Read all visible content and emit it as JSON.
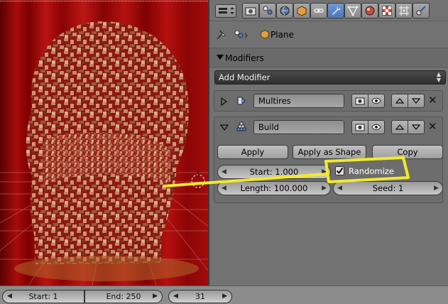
{
  "viewport": {
    "label": "3D viewport with partially built head mesh"
  },
  "properties": {
    "context_tabs": [
      "render",
      "scene",
      "world",
      "object",
      "constraints",
      "modifiers",
      "data",
      "material",
      "texture",
      "particles",
      "physics"
    ],
    "active_tab": "modifiers",
    "path": {
      "object_name": "Plane"
    },
    "section_title": "Modifiers",
    "add_modifier_label": "Add Modifier",
    "modifiers": [
      {
        "name": "Multires",
        "expanded": false
      },
      {
        "name": "Build",
        "expanded": true,
        "apply_label": "Apply",
        "apply_shape_label": "Apply as Shape",
        "copy_label": "Copy",
        "start_label": "Start: 1.000",
        "length_label": "Length: 100.000",
        "randomize_label": "Randomize",
        "randomize_checked": true,
        "seed_label": "Seed: 1"
      }
    ]
  },
  "timeline": {
    "start_label": "Start: 1",
    "end_label": "End: 250",
    "current_frame": "31"
  },
  "colors": {
    "highlight": "#f2ea2a",
    "active_tab": "#5a86c5",
    "viewport_bg": "#a00c0c"
  }
}
